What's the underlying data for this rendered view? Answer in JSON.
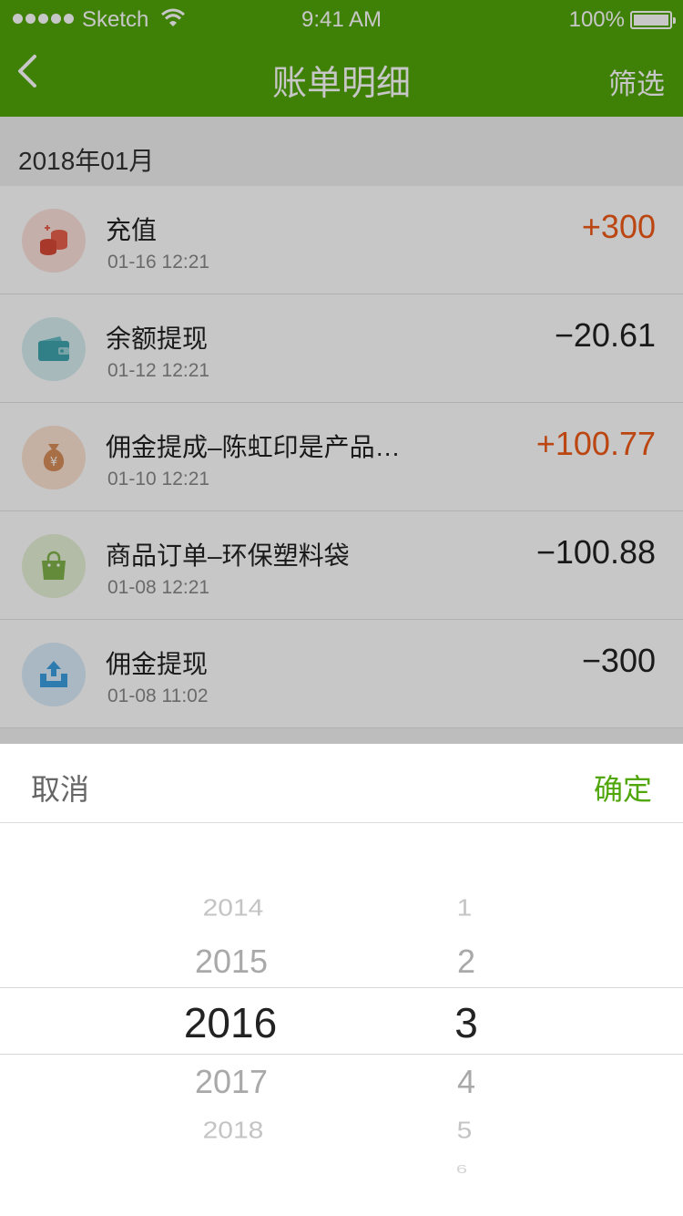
{
  "status_bar": {
    "carrier": "Sketch",
    "time": "9:41 AM",
    "battery": "100%"
  },
  "nav": {
    "title": "账单明细",
    "filter_label": "筛选"
  },
  "month_header": "2018年01月",
  "transactions": [
    {
      "title": "充值",
      "date": "01-16 12:21",
      "amount": "+300",
      "positive": true,
      "icon": "coins-icon",
      "icon_bg": "#fbe1dc",
      "icon_color": "#e8604c"
    },
    {
      "title": "余额提现",
      "date": "01-12 12:21",
      "amount": "−20.61",
      "positive": false,
      "icon": "wallet-icon",
      "icon_bg": "#d6eef0",
      "icon_color": "#3fa3ad"
    },
    {
      "title": "佣金提成–陈虹印是产品…",
      "date": "01-10 12:21",
      "amount": "+100.77",
      "positive": true,
      "icon": "money-bag-icon",
      "icon_bg": "#fbe3d3",
      "icon_color": "#d88f5b"
    },
    {
      "title": "商品订单–环保塑料袋",
      "date": "01-08 12:21",
      "amount": "−100.88",
      "positive": false,
      "icon": "shopping-bag-icon",
      "icon_bg": "#e6f1d5",
      "icon_color": "#7fb24a"
    },
    {
      "title": "佣金提现",
      "date": "01-08 11:02",
      "amount": "−300",
      "positive": false,
      "icon": "upload-tray-icon",
      "icon_bg": "#d9ecfa",
      "icon_color": "#3b9fe0"
    }
  ],
  "picker": {
    "cancel_label": "取消",
    "confirm_label": "确定",
    "years": [
      "2014",
      "2015",
      "2016",
      "2017",
      "2018"
    ],
    "months": [
      "1",
      "2",
      "3",
      "4",
      "5",
      "6"
    ],
    "selected_year": "2016",
    "selected_month": "3"
  },
  "colors": {
    "accent": "#51a60a",
    "positive_amount": "#f05a18"
  }
}
